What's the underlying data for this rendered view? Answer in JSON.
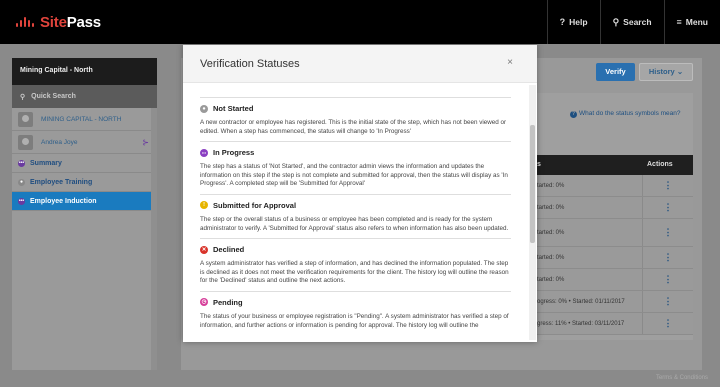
{
  "app": {
    "brand": "SitePass",
    "nav": [
      {
        "icon": "question-icon",
        "glyph": "?",
        "label": "Help"
      },
      {
        "icon": "search-icon",
        "glyph": "⚲",
        "label": "Search"
      },
      {
        "icon": "menu-icon",
        "glyph": "≡",
        "label": "Menu"
      }
    ]
  },
  "sidebar": {
    "header": "Mining Capital - North",
    "search_label": "Quick Search",
    "entities": [
      {
        "label": "MINING CAPITAL - NORTH",
        "icon": "company-avatar-icon"
      },
      {
        "label": "Andrea Joye",
        "icon": "user-avatar-icon"
      }
    ],
    "menu": [
      {
        "label": "Summary",
        "icon": "in-progress-icon",
        "color": "#6a3aa0"
      },
      {
        "label": "Employee Training",
        "icon": "not-started-icon",
        "color": "#888888"
      },
      {
        "label": "Employee Induction",
        "icon": "in-progress-icon",
        "color": "#6a3aa0",
        "active": true
      }
    ]
  },
  "main": {
    "verify_label": "Verify",
    "history_label": "History",
    "status_link": "What do the status symbols mean?",
    "table": {
      "header_partial": "s",
      "actions_header": "Actions",
      "rows": [
        {
          "text": "tarted: 0%"
        },
        {
          "text": "tarted: 0%"
        },
        {
          "text": "tarted: 0%"
        },
        {
          "text": "tarted: 0%"
        },
        {
          "text": "tarted: 0%"
        },
        {
          "text": "ogress: 0% • Started: 01/11/2017"
        },
        {
          "text": "gress: 11% • Started: 03/11/2017"
        }
      ]
    },
    "footer": "Terms & Conditions"
  },
  "modal": {
    "title": "Verification Statuses",
    "close": "×",
    "statuses": [
      {
        "name": "Not Started",
        "icon": "not-started-icon",
        "color": "#9a9a9a",
        "glyph": "●",
        "description": "A new contractor or employee has registered. This is the initial state of the step, which has not been viewed or edited. When a step has commenced, the status will change to 'In Progress'"
      },
      {
        "name": "In Progress",
        "icon": "in-progress-icon",
        "color": "#8a3fc2",
        "glyph": "•••",
        "description": "The step has a status of 'Not Started', and the contractor admin views the information and updates the information on this step if the step is not complete and submitted for approval, then the status will display as 'In Progress'. A completed step will be 'Submitted for Approval'"
      },
      {
        "name": "Submitted for Approval",
        "icon": "submitted-icon",
        "color": "#e6b400",
        "glyph": "!",
        "description": "The step or the overall status of a business or employee has been completed and is ready for the system administrator to verify. A 'Submitted for Approval' status also refers to when information has also been updated."
      },
      {
        "name": "Declined",
        "icon": "declined-icon",
        "color": "#d8332a",
        "glyph": "✕",
        "description": "A system administrator has verified a step of information, and has declined the information populated. The step is declined as it does not meet the verification requirements for the client. The history log will outline the reason for the 'Declined' status and outline the next actions."
      },
      {
        "name": "Pending",
        "icon": "pending-icon",
        "color": "#d63f9a",
        "glyph": "◷",
        "description": "The status of your business or employee registration is \"Pending\". A system administrator has verified a step of information, and further actions or information is pending for approval. The history log will outline the"
      }
    ]
  }
}
